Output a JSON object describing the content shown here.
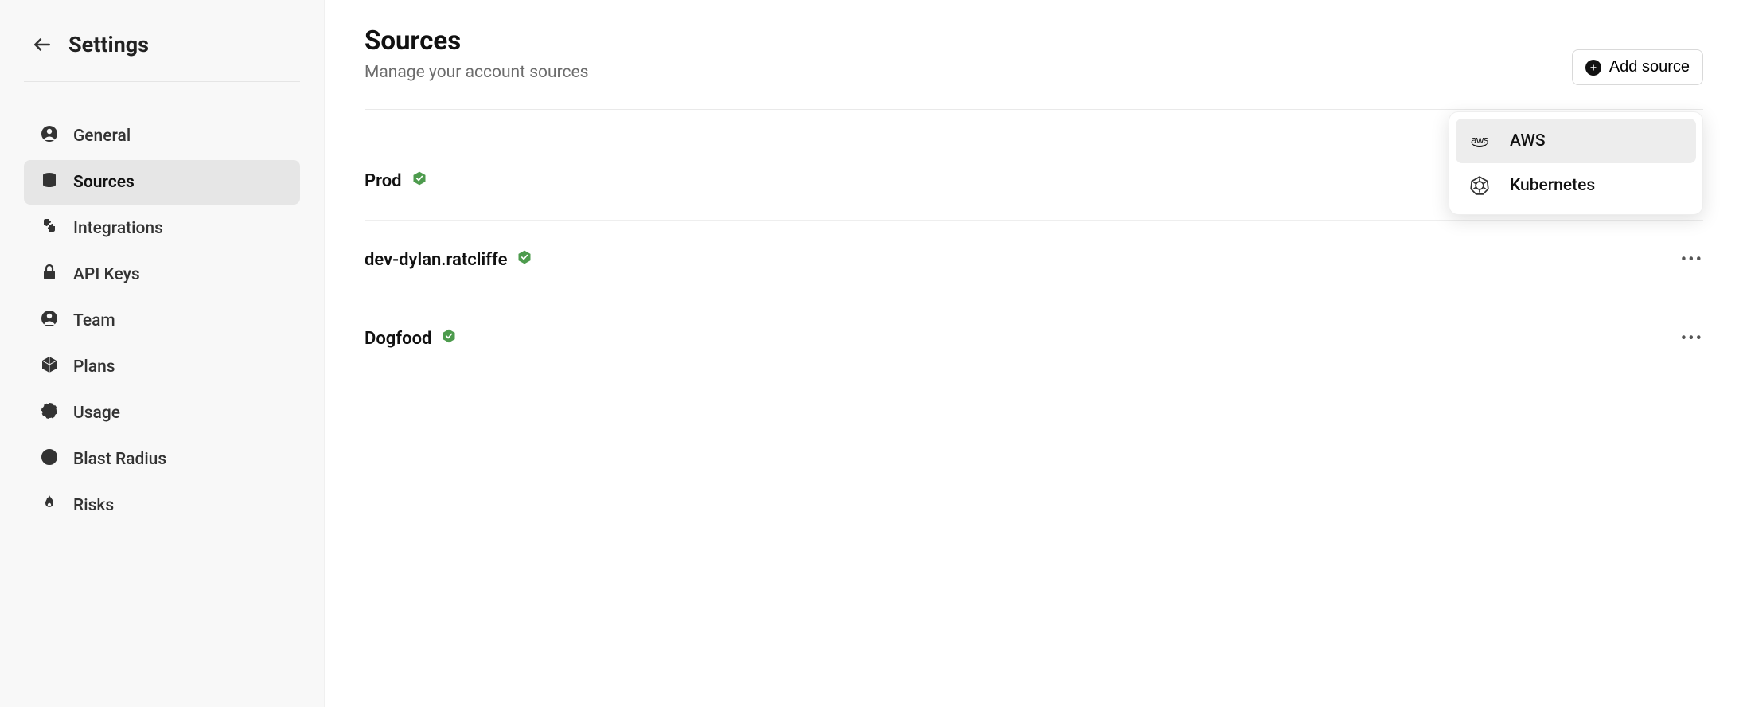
{
  "sidebar": {
    "title": "Settings",
    "items": [
      {
        "label": "General",
        "icon": "user-circle",
        "active": false
      },
      {
        "label": "Sources",
        "icon": "stack",
        "active": true
      },
      {
        "label": "Integrations",
        "icon": "puzzle",
        "active": false
      },
      {
        "label": "API Keys",
        "icon": "lock",
        "active": false
      },
      {
        "label": "Team",
        "icon": "user-circle",
        "active": false
      },
      {
        "label": "Plans",
        "icon": "cube",
        "active": false
      },
      {
        "label": "Usage",
        "icon": "gauge",
        "active": false
      },
      {
        "label": "Blast Radius",
        "icon": "target",
        "active": false
      },
      {
        "label": "Risks",
        "icon": "flame",
        "active": false
      }
    ]
  },
  "page": {
    "title": "Sources",
    "subtitle": "Manage your account sources",
    "add_button": "Add source"
  },
  "dropdown": {
    "items": [
      {
        "label": "AWS",
        "icon": "aws",
        "highlighted": true
      },
      {
        "label": "Kubernetes",
        "icon": "kubernetes",
        "highlighted": false
      }
    ]
  },
  "sources": [
    {
      "name": "Prod",
      "status": "healthy"
    },
    {
      "name": "dev-dylan.ratcliffe",
      "status": "healthy"
    },
    {
      "name": "Dogfood",
      "status": "healthy"
    }
  ]
}
